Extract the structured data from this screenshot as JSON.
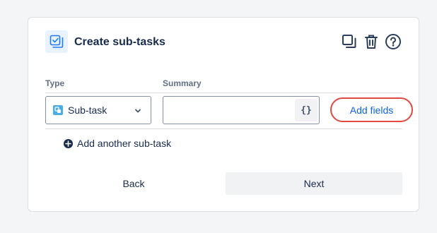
{
  "dialog": {
    "title": "Create sub-tasks",
    "header_icons": [
      "checkbox-icon",
      "copy-icon",
      "trash-icon",
      "help-icon"
    ]
  },
  "columns": {
    "type_label": "Type",
    "summary_label": "Summary"
  },
  "row": {
    "type_value": "Sub-task",
    "summary_value": "",
    "variable_button": "{}"
  },
  "add_fields_label": "Add fields",
  "add_another_label": "Add another sub-task",
  "footer": {
    "back_label": "Back",
    "next_label": "Next"
  },
  "colors": {
    "accent": "#0c66e4",
    "highlight_ring": "#e2483d",
    "subtask_icon": "#4bade8"
  }
}
